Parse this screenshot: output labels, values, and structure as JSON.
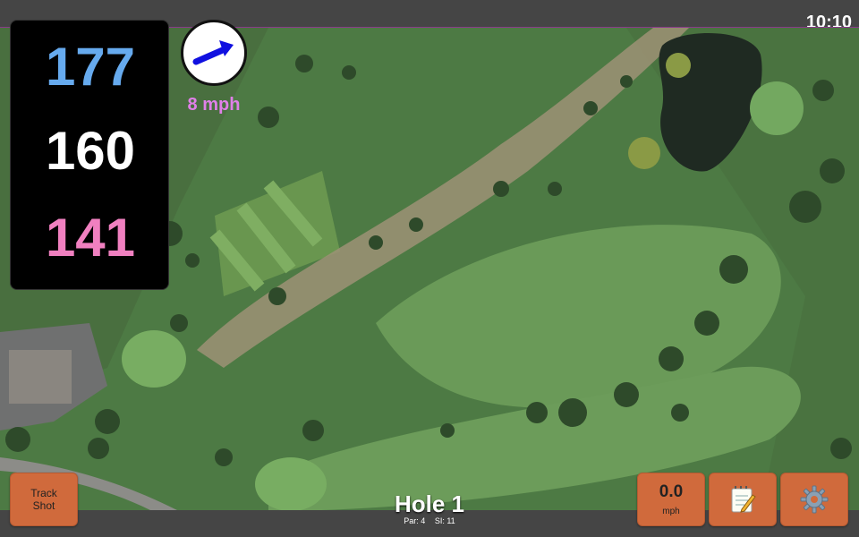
{
  "status": {
    "time": "10:10"
  },
  "distances": {
    "back": "177",
    "middle": "160",
    "front": "141"
  },
  "wind": {
    "speed_label": "8 mph",
    "icon": "wind-arrow-icon"
  },
  "hole": {
    "title": "Hole 1",
    "par_label": "Par: 4",
    "si_label": "SI: 11"
  },
  "buttons": {
    "track_shot_line1": "Track",
    "track_shot_line2": "Shot",
    "speed_value": "0.0",
    "speed_unit": "mph",
    "notes_icon": "notepad-icon",
    "settings_icon": "gear-icon"
  },
  "colors": {
    "back": "#66aaee",
    "middle": "#ffffff",
    "front": "#f080c0",
    "wind_text": "#e080e8",
    "button": "#d06a3c"
  }
}
